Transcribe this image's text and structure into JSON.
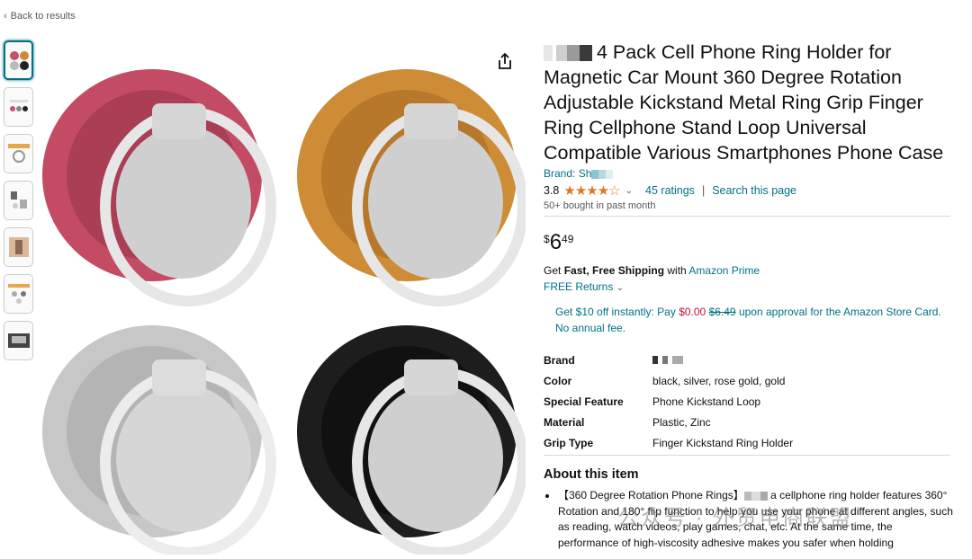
{
  "nav": {
    "back_label": "Back to results"
  },
  "product": {
    "title": "4 Pack Cell Phone Ring Holder for Magnetic Car Mount 360 Degree Rotation Adjustable Kickstand Metal Ring Grip Finger Ring Cellphone Stand Loop Universal Compatible Various Smartphones Phone Case",
    "brand_prefix": "Brand: Sh",
    "rating_value": "3.8",
    "stars_text": "★★★★☆",
    "ratings_count": "45 ratings",
    "search_page": "Search this page",
    "bought": "50+ bought in past month",
    "price": {
      "symbol": "$",
      "whole": "6",
      "fraction": "49"
    }
  },
  "shipping": {
    "prefix": "Get ",
    "bold": "Fast, Free Shipping",
    "mid": " with ",
    "prime": "Amazon Prime",
    "returns": "FREE Returns"
  },
  "card_offer": {
    "text1": "Get $10 off instantly: Pay ",
    "free": "$0.00",
    "strike": "$6.49",
    "text2": " upon approval for the Amazon Store Card. No annual fee."
  },
  "specs": [
    {
      "key": "Brand",
      "value": ""
    },
    {
      "key": "Color",
      "value": "black, silver, rose gold, gold"
    },
    {
      "key": "Special Feature",
      "value": "Phone Kickstand Loop"
    },
    {
      "key": "Material",
      "value": "Plastic, Zinc"
    },
    {
      "key": "Grip Type",
      "value": "Finger Kickstand Ring Holder"
    }
  ],
  "about": {
    "heading": "About this item",
    "bullet_start": "【360 Degree Rotation Phone Rings】",
    "bullet_rest": "a cellphone ring holder features 360° Rotation and 180° flip function to help you use your phone at different angles, such as reading, watch videos, play games, chat, etc. At the same time, the performance of high-viscosity adhesive makes you safer when holding"
  },
  "watermark": "公众号 · 外贸电商联盟",
  "colors": {
    "link": "#007185",
    "star": "#de7921",
    "price_red": "#cc0c39"
  },
  "icons": [
    "share-icon",
    "star-icon",
    "chevron-down-icon"
  ]
}
